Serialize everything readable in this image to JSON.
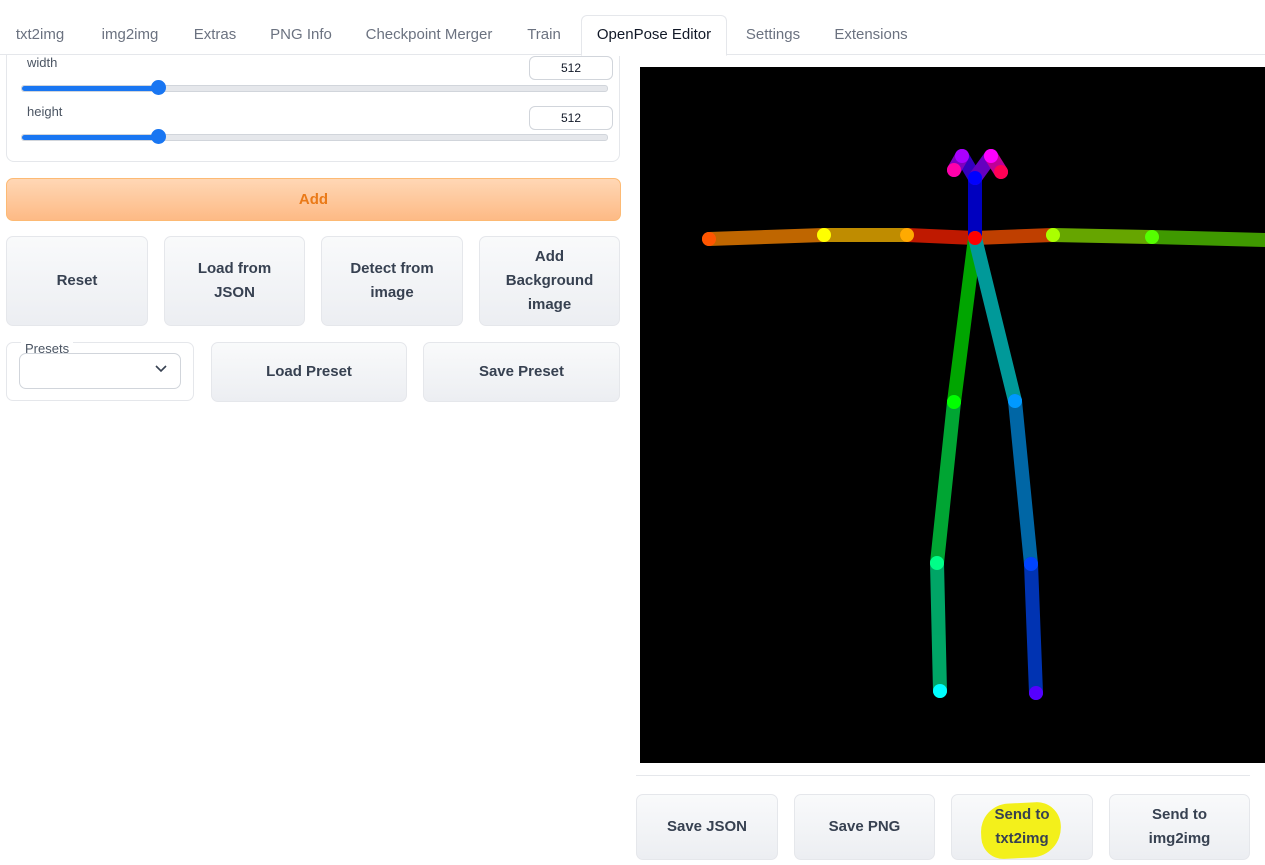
{
  "tabs": [
    "txt2img",
    "img2img",
    "Extras",
    "PNG Info",
    "Checkpoint Merger",
    "Train",
    "OpenPose Editor",
    "Settings",
    "Extensions"
  ],
  "active_tab": "OpenPose Editor",
  "sliders": {
    "width": {
      "label": "width",
      "value": "512",
      "fraction": 0.233
    },
    "height": {
      "label": "height",
      "value": "512",
      "fraction": 0.233
    }
  },
  "buttons": {
    "add": "Add",
    "reset": "Reset",
    "load_json": "Load from JSON",
    "detect": "Detect from image",
    "add_bg": "Add Background image",
    "load_preset": "Load Preset",
    "save_preset": "Save Preset",
    "save_json": "Save JSON",
    "save_png": "Save PNG",
    "send_txt2img": "Send to txt2img",
    "send_img2img": "Send to img2img"
  },
  "presets": {
    "label": "Presets",
    "selected": ""
  },
  "colors": {
    "accent": "#1976f2",
    "add_button_text": "#ea7a18",
    "canvas_bg": "#000000",
    "highlight": "#f3f01b"
  }
}
